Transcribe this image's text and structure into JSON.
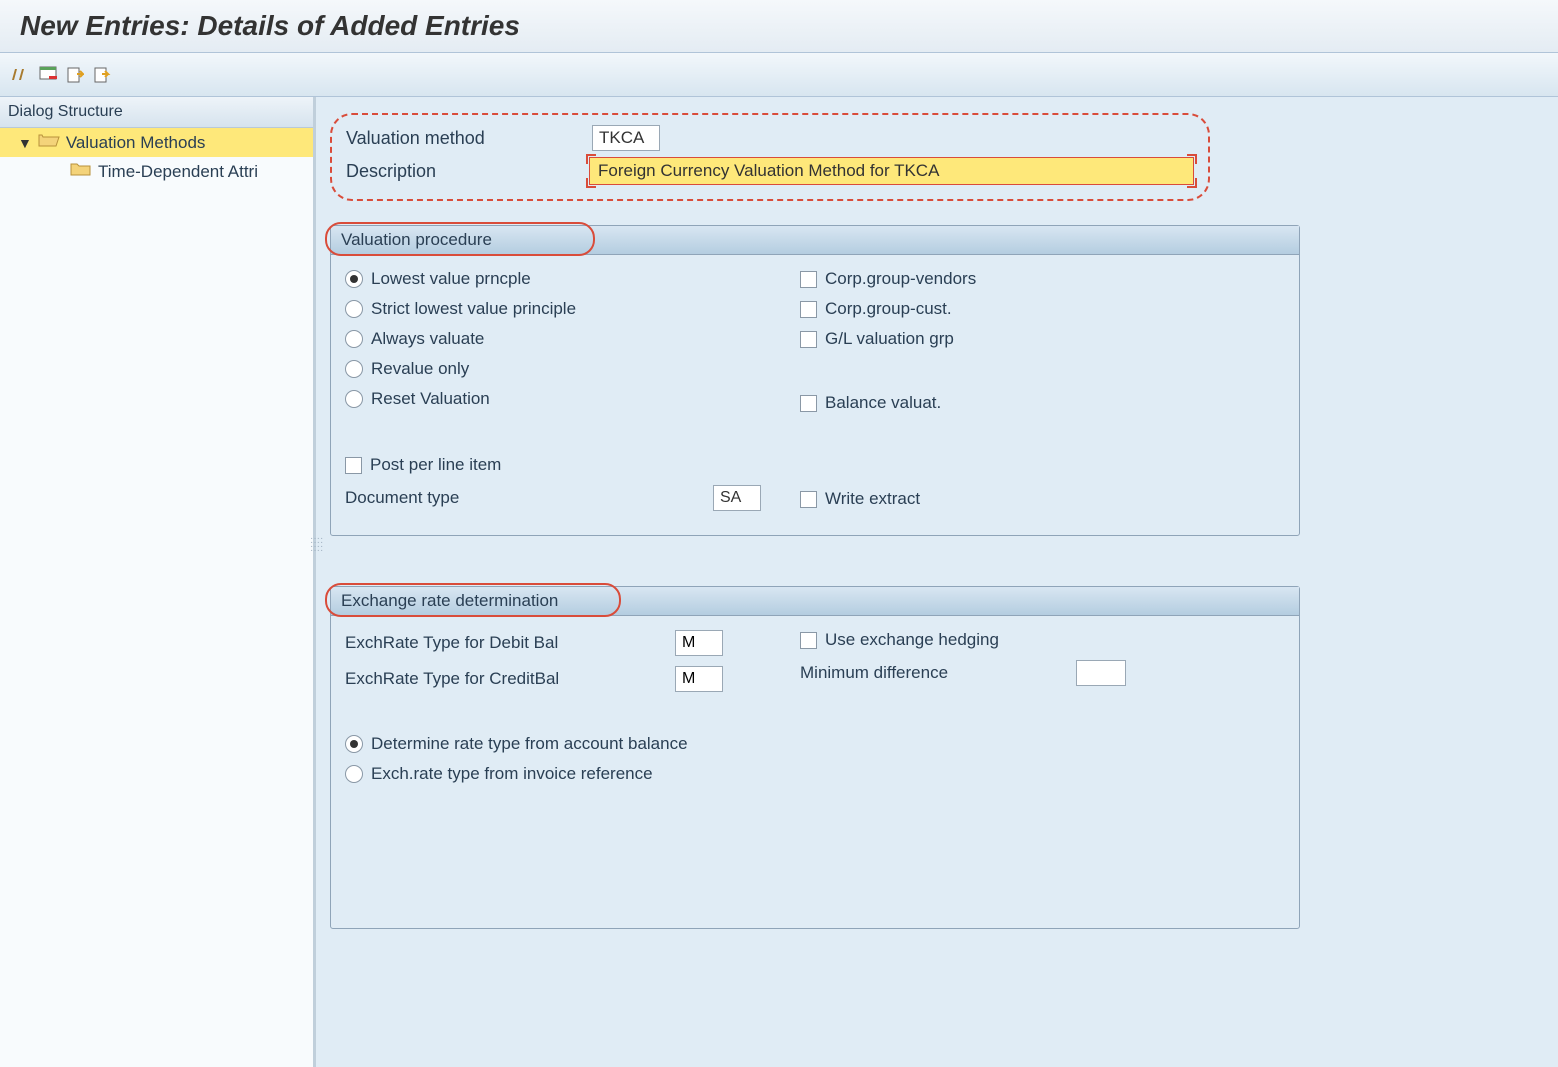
{
  "title": "New Entries: Details of Added Entries",
  "sidebar": {
    "header": "Dialog Structure",
    "items": [
      {
        "label": "Valuation Methods"
      },
      {
        "label": "Time-Dependent Attri"
      }
    ]
  },
  "header": {
    "method_label": "Valuation method",
    "method_value": "TKCA",
    "desc_label": "Description",
    "desc_value": "Foreign Currency Valuation Method for TKCA"
  },
  "valuation_proc": {
    "title": "Valuation procedure",
    "radios": {
      "lowest": "Lowest value prncple",
      "strict": "Strict lowest value principle",
      "always": "Always valuate",
      "revalue": "Revalue only",
      "reset": "Reset Valuation"
    },
    "checks": {
      "corp_vendors": "Corp.group-vendors",
      "corp_cust": "Corp.group-cust.",
      "gl_val": "G/L valuation grp",
      "balance": "Balance valuat.",
      "post_per_line": "Post per line item",
      "write_extract": "Write extract"
    },
    "doc_type_label": "Document type",
    "doc_type_value": "SA"
  },
  "exchange": {
    "title": "Exchange rate determination",
    "debit_label": "ExchRate Type for Debit Bal",
    "debit_value": "M",
    "credit_label": "ExchRate Type for CreditBal",
    "credit_value": "M",
    "use_hedging": "Use exchange hedging",
    "min_diff": "Minimum difference",
    "radios": {
      "from_balance": "Determine rate type from account balance",
      "from_invoice": "Exch.rate type from invoice reference"
    }
  }
}
